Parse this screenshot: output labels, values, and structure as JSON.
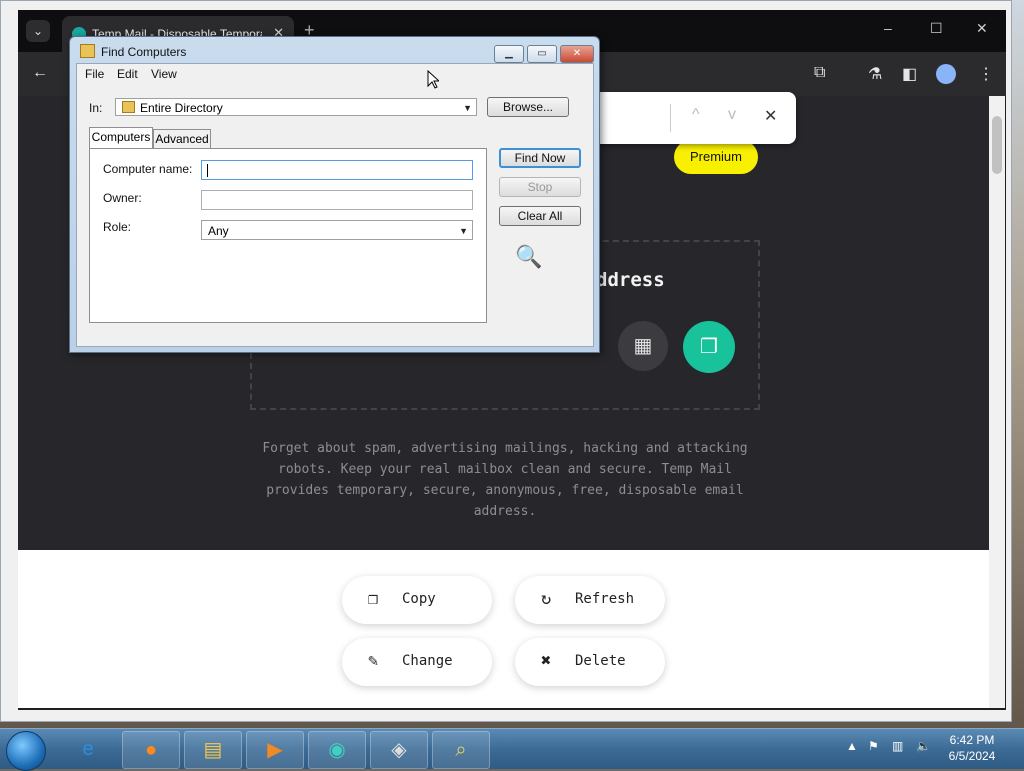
{
  "browser": {
    "tab_title": "Temp Mail - Disposable Temporary Email",
    "tab_close": "✕",
    "new_tab": "+",
    "window_controls": [
      "–",
      "☐",
      "✕"
    ],
    "find_bar": {
      "prev": "^",
      "next": "v",
      "close": "✕"
    },
    "icons": [
      "back-arrow-icon",
      "extensions-icon",
      "labs-flask-icon",
      "side-panel-icon",
      "profile-icon",
      "kebab-menu-icon"
    ]
  },
  "page": {
    "premium_label": "Premium",
    "box_title": "ddress",
    "description": "Forget about spam, advertising mailings, hacking and attacking robots. Keep your real mailbox clean and secure. Temp Mail provides temporary, secure, anonymous, free, disposable email address.",
    "actions": [
      {
        "label": "Copy",
        "icon": "copy-icon"
      },
      {
        "label": "Refresh",
        "icon": "refresh-icon"
      },
      {
        "label": "Change",
        "icon": "edit-icon"
      },
      {
        "label": "Delete",
        "icon": "delete-x-icon"
      }
    ]
  },
  "dialog": {
    "title": "Find Computers",
    "menu": [
      "File",
      "Edit",
      "View"
    ],
    "in_label": "In:",
    "in_value": "Entire Directory",
    "browse_label": "Browse...",
    "tabs": [
      "Computers",
      "Advanced"
    ],
    "computer_name_label": "Computer name:",
    "computer_name_value": "",
    "owner_label": "Owner:",
    "owner_value": "",
    "role_label": "Role:",
    "role_value": "Any",
    "find_now_label": "Find Now",
    "stop_label": "Stop",
    "clear_all_label": "Clear All"
  },
  "taskbar": {
    "apps": [
      "internet-explorer-icon",
      "firefox-icon",
      "file-explorer-icon",
      "media-player-icon",
      "app-icon",
      "unity-icon",
      "find-computers-icon"
    ],
    "time": "6:42 PM",
    "date": "6/5/2024"
  }
}
